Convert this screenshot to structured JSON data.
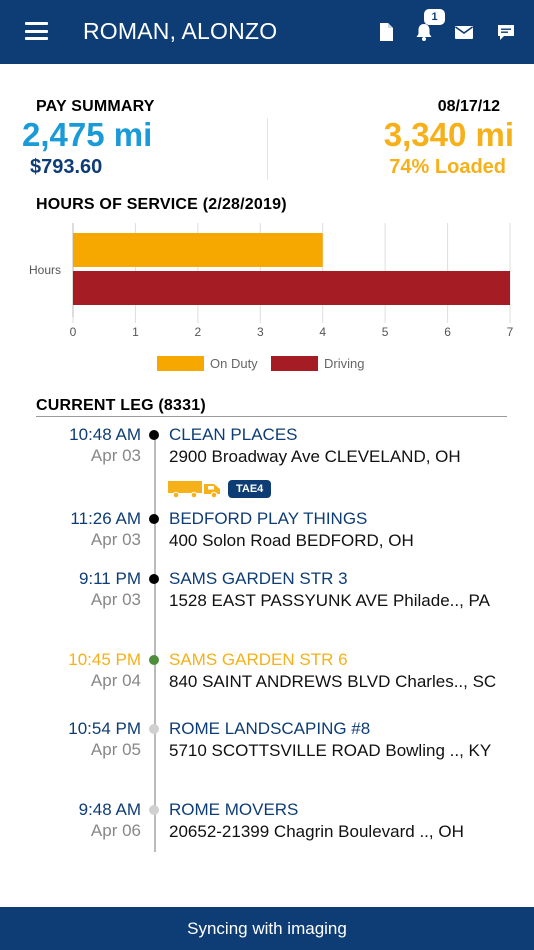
{
  "header": {
    "title": "ROMAN, ALONZO",
    "notification_count": "1",
    "icons": [
      "menu-icon",
      "document-icon",
      "bell-icon",
      "mail-icon",
      "chat-icon"
    ]
  },
  "pay_summary": {
    "label": "PAY SUMMARY",
    "date": "08/17/12",
    "miles_paid": "2,475 mi",
    "amount": "$793.60",
    "miles_total": "3,340 mi",
    "loaded": "74% Loaded"
  },
  "hours_of_service": {
    "title": "HOURS OF SERVICE (2/28/2019)"
  },
  "chart_data": {
    "type": "bar",
    "orientation": "horizontal",
    "categories": [
      "Hours"
    ],
    "series": [
      {
        "name": "On Duty",
        "values": [
          4
        ],
        "color": "#f6a800"
      },
      {
        "name": "Driving",
        "values": [
          7
        ],
        "color": "#a51c24"
      }
    ],
    "xlim": [
      0,
      7
    ],
    "xticks": [
      0,
      1,
      2,
      3,
      4,
      5,
      6,
      7
    ],
    "grid": true,
    "legend": "bottom"
  },
  "current_leg": {
    "title": "CURRENT LEG (8331)",
    "truck": {
      "icon": "truck-icon",
      "tag": "TAE4",
      "color": "#f6b019"
    },
    "stops": [
      {
        "time": "10:48 AM",
        "date": "Apr 03",
        "name": "CLEAN PLACES",
        "address": "2900 Broadway Ave CLEVELAND, OH",
        "status": "completed"
      },
      {
        "time": "11:26 AM",
        "date": "Apr 03",
        "name": "BEDFORD PLAY THINGS",
        "address": "400 Solon Road BEDFORD, OH",
        "status": "completed"
      },
      {
        "time": "9:11 PM",
        "date": "Apr 03",
        "name": "SAMS GARDEN STR 3",
        "address": "1528 EAST PASSYUNK AVE Philade.., PA",
        "status": "completed"
      },
      {
        "time": "10:45 PM",
        "date": "Apr 04",
        "name": "SAMS GARDEN STR 6",
        "address": "840 SAINT ANDREWS BLVD Charles.., SC",
        "status": "active"
      },
      {
        "time": "10:54 PM",
        "date": "Apr 05",
        "name": "ROME LANDSCAPING #8",
        "address": "5710 SCOTTSVILLE ROAD Bowling .., KY",
        "status": "future"
      },
      {
        "time": "9:48 AM",
        "date": "Apr 06",
        "name": "ROME MOVERS",
        "address": "20652-21399 Chagrin Boulevard .., OH",
        "status": "future"
      }
    ]
  },
  "footer": {
    "status": "Syncing with imaging"
  }
}
